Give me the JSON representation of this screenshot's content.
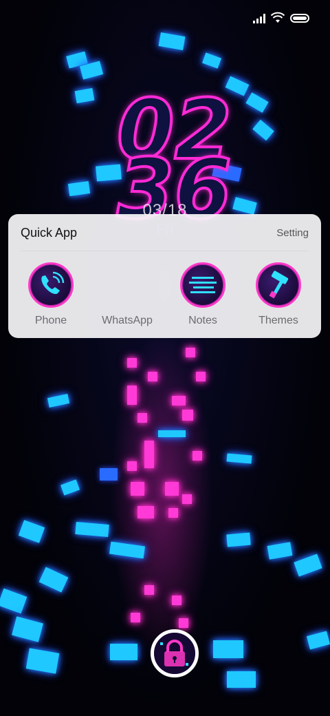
{
  "clock": {
    "hour": "02",
    "minute": "36",
    "date": "03/18",
    "day": "Fri"
  },
  "quick_app": {
    "title": "Quick App",
    "setting_label": "Setting",
    "apps": [
      {
        "label": "Phone",
        "icon": "phone-icon",
        "has_icon": true
      },
      {
        "label": "WhatsApp",
        "icon": "whatsapp-icon",
        "has_icon": false
      },
      {
        "label": "Notes",
        "icon": "notes-icon",
        "has_icon": true
      },
      {
        "label": "Themes",
        "icon": "themes-icon",
        "has_icon": true
      }
    ]
  },
  "status": {
    "signal": "signal-icon",
    "wifi": "wifi-icon",
    "battery": "battery-icon"
  },
  "lock": {
    "icon": "lock-icon"
  },
  "colors": {
    "neon_pink": "#ff2ad6",
    "neon_cyan": "#1fc8ff",
    "panel_bg": "#f5f5f7"
  }
}
